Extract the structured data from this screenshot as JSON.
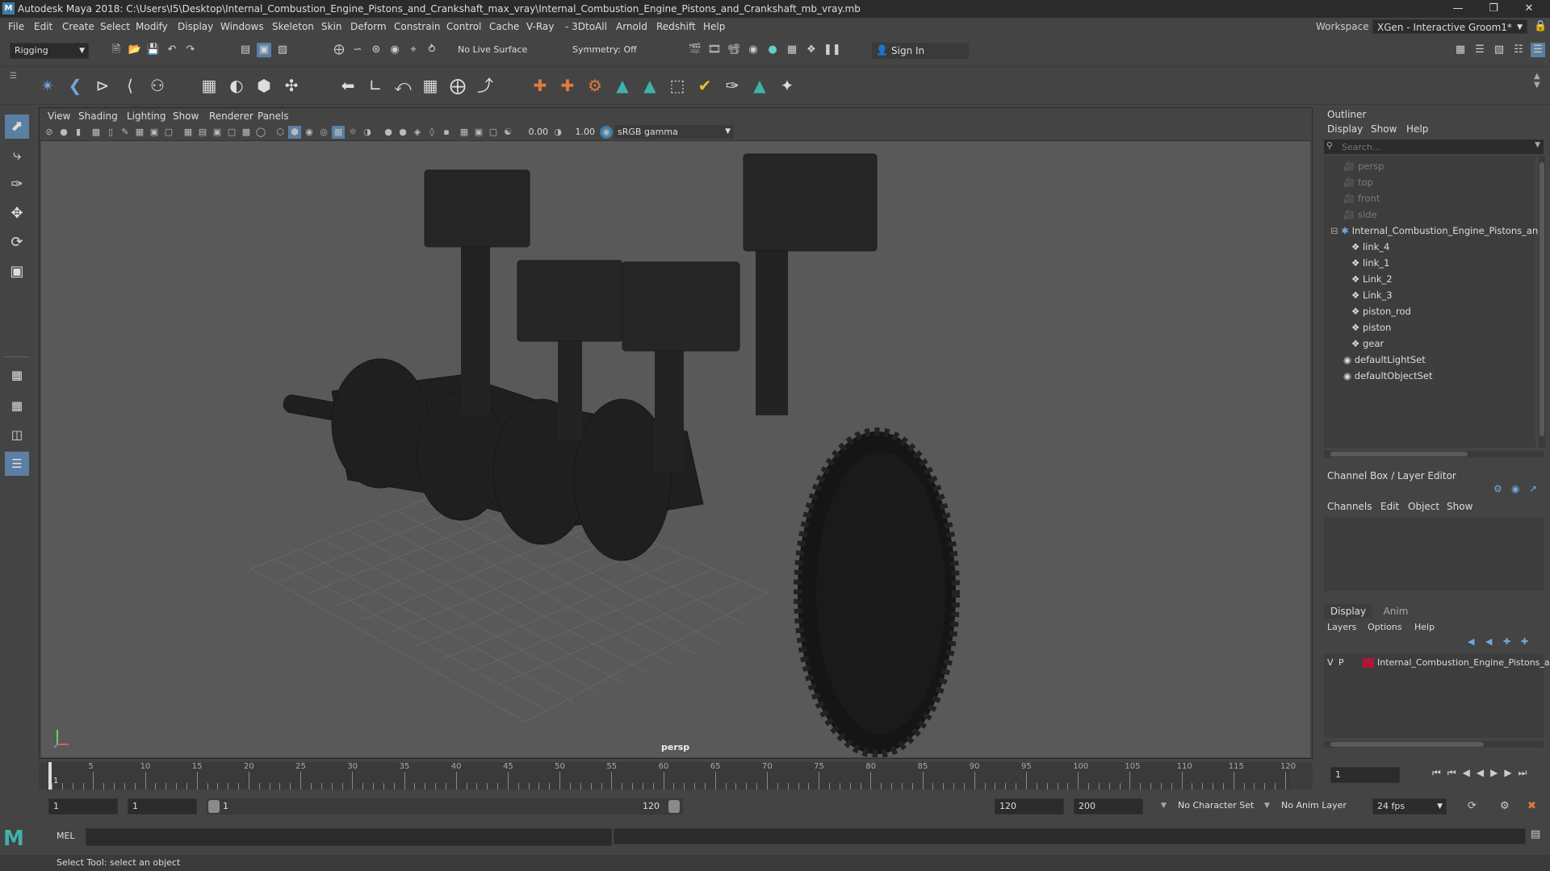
{
  "window": {
    "title": "Autodesk Maya 2018: C:\\Users\\I5\\Desktop\\Internal_Combustion_Engine_Pistons_and_Crankshaft_max_vray\\Internal_Combustion_Engine_Pistons_and_Crankshaft_mb_vray.mb",
    "app_icon": "M"
  },
  "menubar": {
    "items": [
      "File",
      "Edit",
      "Create",
      "Select",
      "Modify",
      "Display",
      "Windows",
      "Skeleton",
      "Skin",
      "Deform",
      "Constrain",
      "Control",
      "Cache",
      "V-Ray",
      "3DtoAll",
      "Arnold",
      "Redshift",
      "Help"
    ],
    "workspace_label": "Workspace :",
    "workspace_value": "XGen - Interactive Groom1*"
  },
  "statusline": {
    "menuset": "Rigging",
    "live_surface": "No Live Surface",
    "symmetry": "Symmetry: Off",
    "sign_in": "Sign In"
  },
  "viewport": {
    "menu": [
      "View",
      "Shading",
      "Lighting",
      "Show",
      "Renderer",
      "Panels"
    ],
    "exposure": "0.00",
    "gamma": "1.00",
    "colorspace": "sRGB gamma",
    "camera_label": "persp",
    "colors": {
      "background": "#595959",
      "model": "#1e1e1e",
      "grid": "#6a6a6a"
    }
  },
  "outliner": {
    "title": "Outliner",
    "menu": [
      "Display",
      "Show",
      "Help"
    ],
    "search_placeholder": "Search...",
    "cameras": [
      "persp",
      "top",
      "front",
      "side"
    ],
    "group": "Internal_Combustion_Engine_Pistons_and",
    "children": [
      "link_4",
      "link_1",
      "Link_2",
      "Link_3",
      "piston_rod",
      "piston",
      "gear"
    ],
    "sets": [
      "defaultLightSet",
      "defaultObjectSet"
    ]
  },
  "channelbox": {
    "title": "Channel Box / Layer Editor",
    "menu": [
      "Channels",
      "Edit",
      "Object",
      "Show"
    ],
    "tabs": [
      "Display",
      "Anim"
    ],
    "layer_menu": [
      "Layers",
      "Options",
      "Help"
    ],
    "layer": {
      "v": "V",
      "p": "P",
      "name": "Internal_Combustion_Engine_Pistons_a",
      "color": "#b0163a"
    }
  },
  "timeslider": {
    "ticks": [
      "5",
      "10",
      "15",
      "20",
      "25",
      "30",
      "35",
      "40",
      "45",
      "50",
      "55",
      "60",
      "65",
      "70",
      "75",
      "80",
      "85",
      "90",
      "95",
      "100",
      "105",
      "110",
      "115",
      "120"
    ],
    "current_frame": "1",
    "current_marker": "1"
  },
  "rangeslider": {
    "start": "1",
    "playback_start": "1",
    "slider_start": "1",
    "slider_end": "120",
    "playback_end": "120",
    "end": "200",
    "character_set": "No Character Set",
    "anim_layer": "No Anim Layer",
    "fps": "24 fps"
  },
  "commandline": {
    "label": "MEL"
  },
  "helpline": {
    "text": "Select Tool: select an object"
  }
}
